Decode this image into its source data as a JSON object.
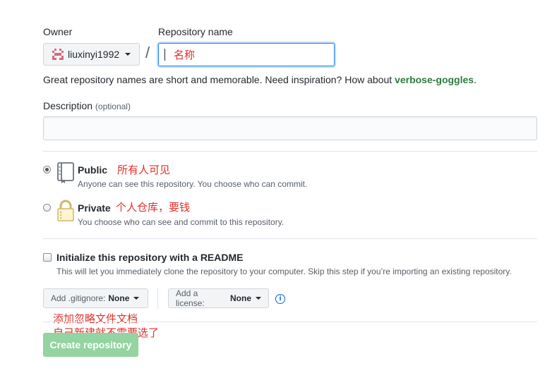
{
  "owner": {
    "label": "Owner",
    "name": "liuxinyi1992"
  },
  "repo": {
    "label": "Repository name",
    "value": "名称",
    "separator": "/"
  },
  "hint": {
    "text": "Great repository names are short and memorable. Need inspiration? How about ",
    "suggestion": "verbose-goggles",
    "end": "."
  },
  "description": {
    "label": "Description",
    "optional": "(optional)",
    "value": ""
  },
  "visibility": {
    "public": {
      "title": "Public",
      "note": "Anyone can see this repository. You choose who can commit.",
      "annotation": "所有人可见",
      "selected": true,
      "icon": "repo-icon"
    },
    "private": {
      "title": "Private",
      "note": "You choose who can see and commit to this repository.",
      "annotation": "个人仓库，要钱",
      "selected": false,
      "icon": "lock-icon"
    }
  },
  "readme": {
    "title": "Initialize this repository with a README",
    "note": "This will let you immediately clone the repository to your computer. Skip this step if you’re importing an existing repository.",
    "checked": false
  },
  "gitignore": {
    "label": "Add .gitignore:",
    "value": "None"
  },
  "license": {
    "label": "Add a license:",
    "value": "None"
  },
  "annotations": {
    "line1": "添加忽略文件文档",
    "line2": "自己新建就不需要选了"
  },
  "create_button": "Create repository",
  "colors": {
    "accent_green": "#94d3a2",
    "annotation_red": "#e0302c",
    "focus_blue": "#2188ff"
  }
}
